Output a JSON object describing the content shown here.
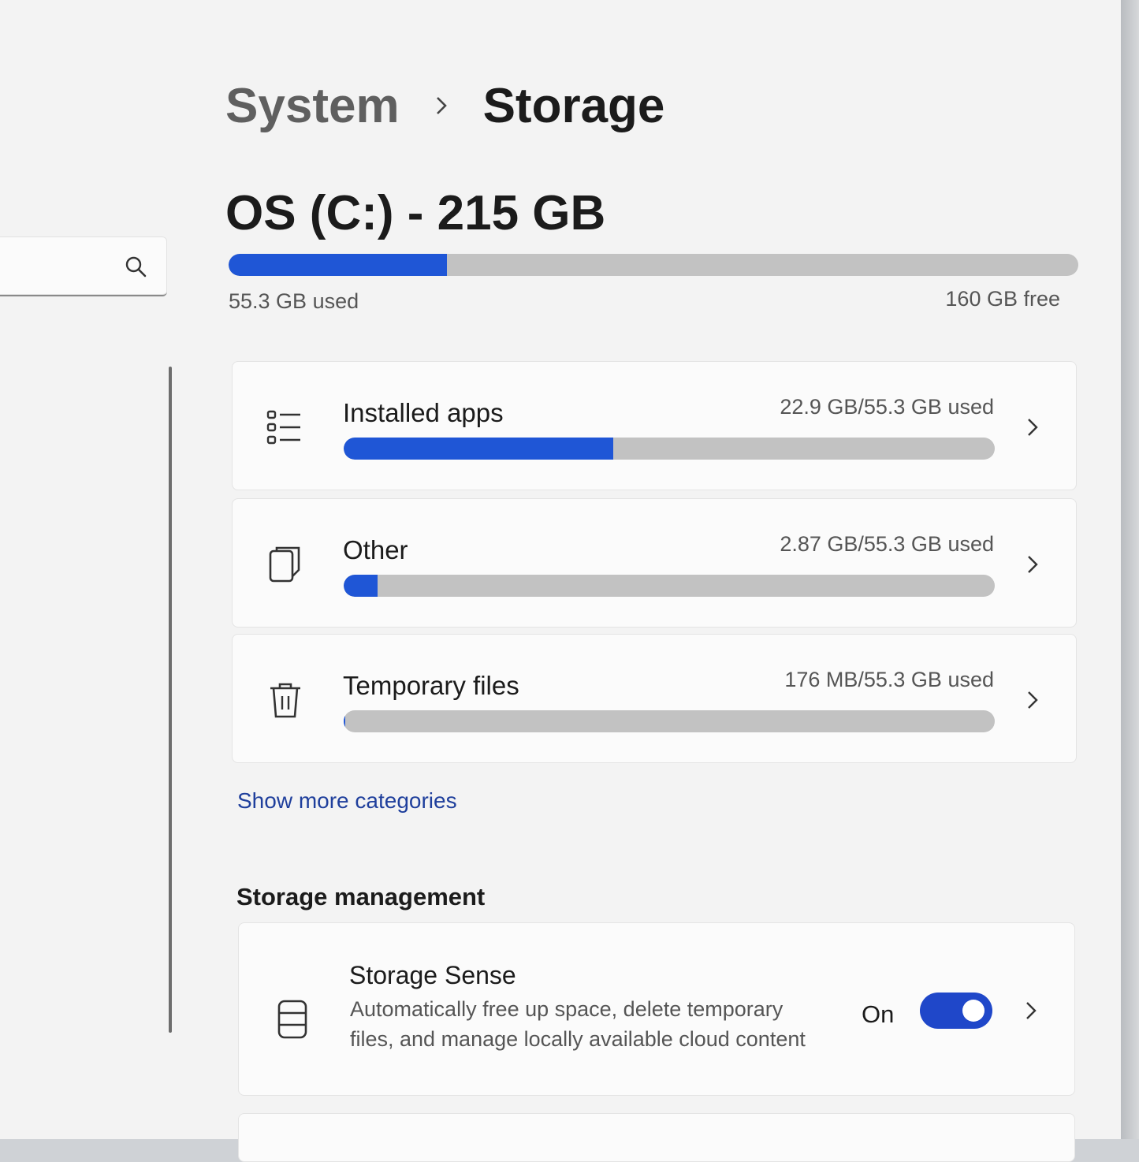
{
  "breadcrumb": {
    "parent": "System",
    "current": "Storage"
  },
  "search": {
    "placeholder": ""
  },
  "drive": {
    "title": "OS (C:) - 215 GB",
    "used_label": "55.3 GB used",
    "free_label": "160 GB free",
    "used_fraction": 0.257
  },
  "categories": [
    {
      "label": "Installed apps",
      "amount": "22.9 GB/55.3 GB used",
      "fraction": 0.414,
      "icon": "list-icon"
    },
    {
      "label": "Other",
      "amount": "2.87 GB/55.3 GB used",
      "fraction": 0.052,
      "icon": "document-icon"
    },
    {
      "label": "Temporary files",
      "amount": "176 MB/55.3 GB used",
      "fraction": 0.003,
      "icon": "trash-icon"
    }
  ],
  "show_more": "Show more categories",
  "storage_management": {
    "title": "Storage management",
    "sense": {
      "title": "Storage Sense",
      "description": "Automatically free up space, delete temporary files, and manage locally available cloud content",
      "state": "On",
      "enabled": true
    }
  },
  "colors": {
    "accent": "#1f56d6",
    "track": "#c2c2c2",
    "link": "#1f3f9c"
  }
}
